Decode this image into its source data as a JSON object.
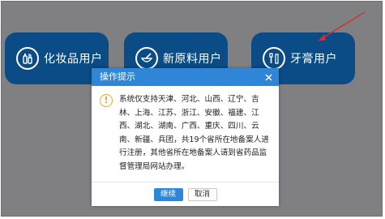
{
  "tiles": [
    {
      "label": "化妆品用户",
      "icon": "cosmetics-icon"
    },
    {
      "label": "新原料用户",
      "icon": "mortar-pestle-icon"
    },
    {
      "label": "牙膏用户",
      "icon": "toothbrush-icon"
    }
  ],
  "dialog": {
    "title": "操作提示",
    "close_icon": "close-icon",
    "warning_icon": "warning-icon",
    "message": "系统仅支持天津、河北、山西、辽宁、吉林、上海、江苏、浙江、安徽、福建、江西、湖北、湖南、广西、重庆、四川、云南、新疆、兵团，共19个省所在地备案人进行注册，其他省所在地备案人请到省药品监督管理局网站办理。",
    "confirm_label": "继续",
    "cancel_label": "取消"
  },
  "colors": {
    "tile": "#0b4c86",
    "dialog_header": "#2f86d6",
    "primary_button": "#2f86d6",
    "warning": "#f5a623",
    "annotation_arrow": "#d32f2f"
  }
}
